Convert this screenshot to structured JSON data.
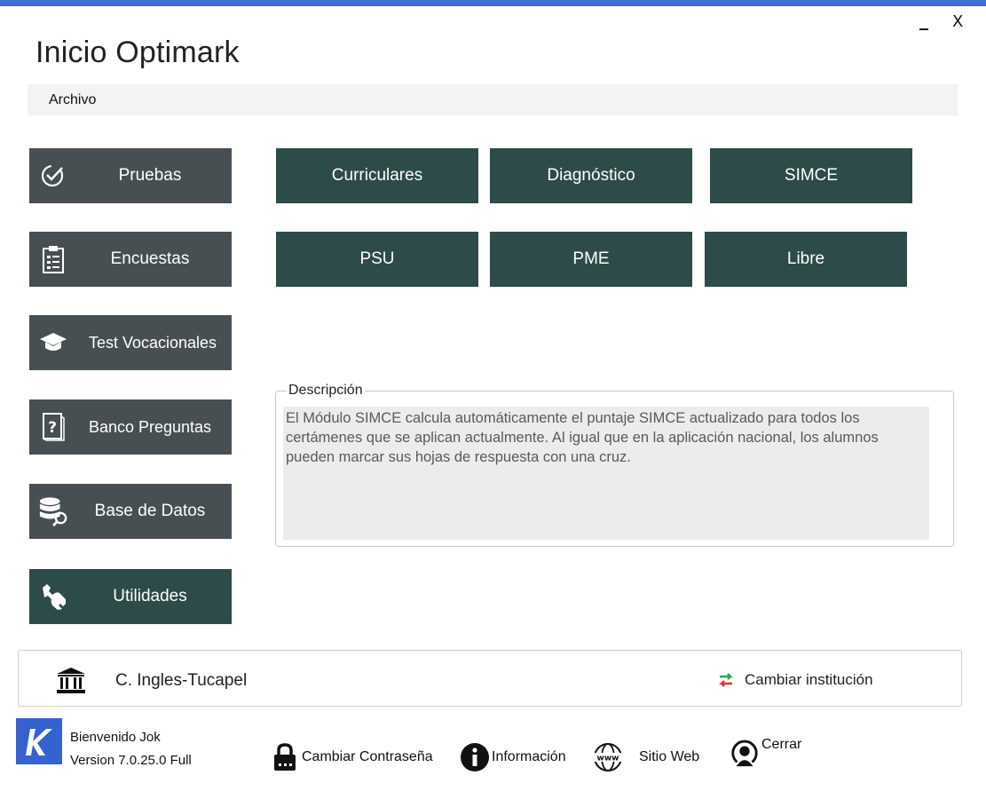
{
  "window": {
    "title": "Inicio Optimark",
    "minimize_glyph": "_",
    "close_glyph": "X",
    "accent_color": "#3e6bd6"
  },
  "menu": {
    "items": [
      {
        "label": "Archivo"
      }
    ]
  },
  "sidebar": {
    "items": [
      {
        "label": "Pruebas",
        "icon": "check-circle-icon"
      },
      {
        "label": "Encuestas",
        "icon": "clipboard-icon"
      },
      {
        "label": "Test Vocacionales",
        "icon": "graduation-cap-icon"
      },
      {
        "label": "Banco Preguntas",
        "icon": "question-book-icon"
      },
      {
        "label": "Base de Datos",
        "icon": "database-icon"
      },
      {
        "label": "Utilidades",
        "icon": "wrench-icon"
      }
    ],
    "colors": {
      "default": "#474f53",
      "active": "#2d4b48"
    }
  },
  "tests": {
    "buttons": [
      {
        "label": "Curriculares"
      },
      {
        "label": "Diagnóstico"
      },
      {
        "label": "SIMCE"
      },
      {
        "label": "PSU"
      },
      {
        "label": "PME"
      },
      {
        "label": "Libre"
      }
    ],
    "color": "#2d4b48"
  },
  "description": {
    "legend": "Descripción",
    "text": "El Módulo SIMCE calcula automáticamente el puntaje SIMCE actualizado para todos los certámenes que se aplican actualmente. Al igual que en la aplicación nacional, los alumnos pueden marcar sus hojas de respuesta con una cruz."
  },
  "institution": {
    "name": "C. Ingles-Tucapel",
    "change_label": "Cambiar institución"
  },
  "footer": {
    "logo_letter": "K",
    "welcome": "Bienvenido Jok",
    "version": "Version 7.0.25.0 Full",
    "links": [
      {
        "label": "Cambiar Contraseña",
        "icon": "lock-icon"
      },
      {
        "label": "Información",
        "icon": "info-icon"
      },
      {
        "label": "Sitio Web",
        "icon": "globe-www-icon"
      },
      {
        "label": "Cerrar",
        "icon": "user-logout-icon"
      }
    ]
  }
}
